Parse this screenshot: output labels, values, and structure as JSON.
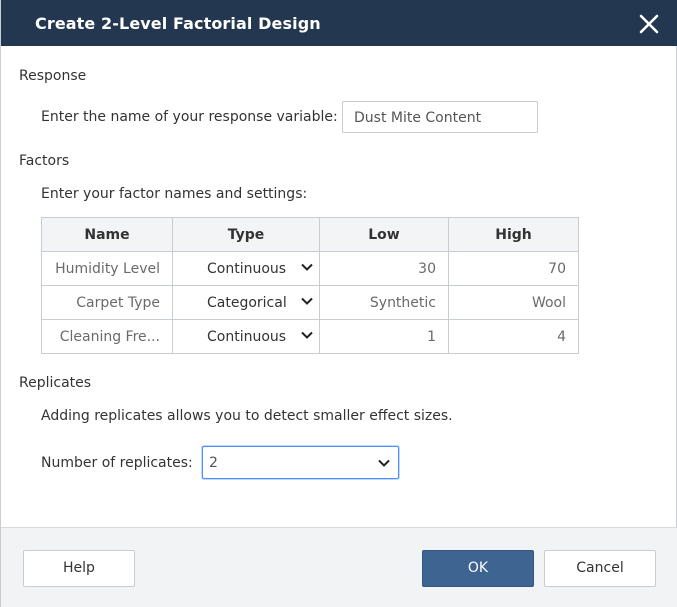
{
  "dialog": {
    "title": "Create 2-Level Factorial Design"
  },
  "response": {
    "section_label": "Response",
    "prompt": "Enter the name of your response variable:",
    "value": "Dust Mite Content"
  },
  "factors": {
    "section_label": "Factors",
    "prompt": "Enter your factor names and settings:",
    "columns": [
      "Name",
      "Type",
      "Low",
      "High"
    ],
    "rows": [
      {
        "name": "Humidity Level",
        "type": "Continuous",
        "low": "30",
        "high": "70"
      },
      {
        "name": "Carpet Type",
        "type": "Categorical",
        "low": "Synthetic",
        "high": "Wool"
      },
      {
        "name": "Cleaning Fre...",
        "type": "Continuous",
        "low": "1",
        "high": "4"
      }
    ]
  },
  "replicates": {
    "section_label": "Replicates",
    "info": "Adding replicates allows you to detect smaller effect sizes.",
    "label": "Number of replicates:",
    "selected": "2"
  },
  "footer": {
    "help_label": "Help",
    "ok_label": "OK",
    "cancel_label": "Cancel"
  },
  "colors": {
    "titlebar": "#243750",
    "primary_button": "#3e6591",
    "focus_border": "#4d90fe"
  },
  "icons": {
    "close": "close-icon",
    "dropdown": "chevron-down-icon"
  }
}
